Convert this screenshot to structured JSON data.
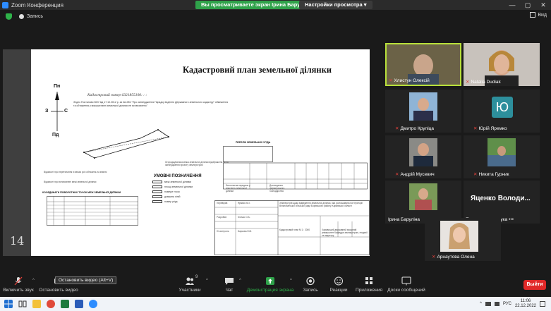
{
  "window": {
    "app_title": "Zoom Конференция",
    "share_banner": "Вы просматриваете экран Ірина Баруліна",
    "view_options": "Настройки просмотра",
    "controls": [
      "—",
      "▢",
      "✕"
    ]
  },
  "recording": {
    "label": "Запись",
    "view_label": "Вид"
  },
  "document": {
    "title": "Кадастровий план земельної ділянки",
    "cadastral_number": "Кадастровий номер 6321855100:   :   :",
    "note": "Згідно Постанови КМУ від 17.10.2012 р. за №1051 \"Про затвердження Порядку ведення Державного земельного кадастру\" обмеження та обтяження у використанні земельної ділянки не встановлено\"",
    "compass": {
      "north": "Пн",
      "south": "Пд",
      "west": "З",
      "east": "С"
    },
    "page_number": "14",
    "legend_title": "УМОВНІ ПОЗНАЧЕННЯ",
    "legend_items": [
      "межі земельної ділянки",
      "площі земельної ділянки",
      "номери точок",
      "довжина ліній",
      "номер угідь"
    ],
    "coords_title": "КООРДИНАТИ ПОВОРОТНИХ ТОЧОК МЕЖ ЗЕМЕЛЬНОЇ ДІЛЯНКИ",
    "info_left": "Відомості про перетинання в межах усіх обтяжень на землю",
    "info_left2": "Відомості про встановлені межі земельної ділянки",
    "restrictions_note": "Огороджувальна межа земельної ділянки відображена після затвердження проекту землеустрою",
    "land_table_title": "ПЕРЕЛІК ЗЕМЕЛЬНИХ УГІДЬ",
    "usage_row": "Безоплатна передача у власність земельної ділянки",
    "purpose": "Для ведення фермерського господарства",
    "stamp": {
      "performer_label": "Розробив",
      "performer": "Клочко О.А.",
      "checked_label": "Перевірив",
      "checked": "Ярмеко Ю.І.",
      "control_label": "Н/ контроль",
      "control": "Барсова Н.М.",
      "project": "Землеустрій щодо відведення земельної ділянки, яка розташована на території Вільнохатської сільської ради Борівського району Харківської області",
      "scale": "Кадастровий план М 1 : 2000",
      "org": "Харківський державний аграрний університет Кафедра землеустрою, геодезії та кадастру"
    }
  },
  "participants": [
    {
      "name": "Хлистун Олексій",
      "muted": true,
      "active": true
    },
    {
      "name": "Natalia Dudiak",
      "muted": true
    },
    {
      "name": "Дмитро Круліца",
      "muted": true
    },
    {
      "name": "Юрій Яремко",
      "muted": true,
      "avatar_letter": "Ю"
    },
    {
      "name": "Андрій Мусевич",
      "muted": true
    },
    {
      "name": "Никита Гурник",
      "muted": true
    },
    {
      "name": "Ірина Баруліна",
      "muted": false
    },
    {
      "name": "Яценко Володи...",
      "muted": false,
      "status": "Подключение звука",
      "big": true
    },
    {
      "name": "Арнаутова Олена",
      "muted": true
    }
  ],
  "toolbar": {
    "mic_label": "Включить звук",
    "video_label": "Остановить видео",
    "tooltip": "Остановить видео (Alt+V)",
    "participants_label": "Участники",
    "participants_count": "9",
    "chat_label": "Чат",
    "share_label": "Демонстрация экрана",
    "record_label": "Запись",
    "reactions_label": "Реакции",
    "apps_label": "Приложения",
    "whiteboard_label": "Доски сообщений",
    "leave_label": "Выйти"
  },
  "taskbar": {
    "lang": "РУС",
    "time": "11:06",
    "date": "22.12.2022"
  }
}
